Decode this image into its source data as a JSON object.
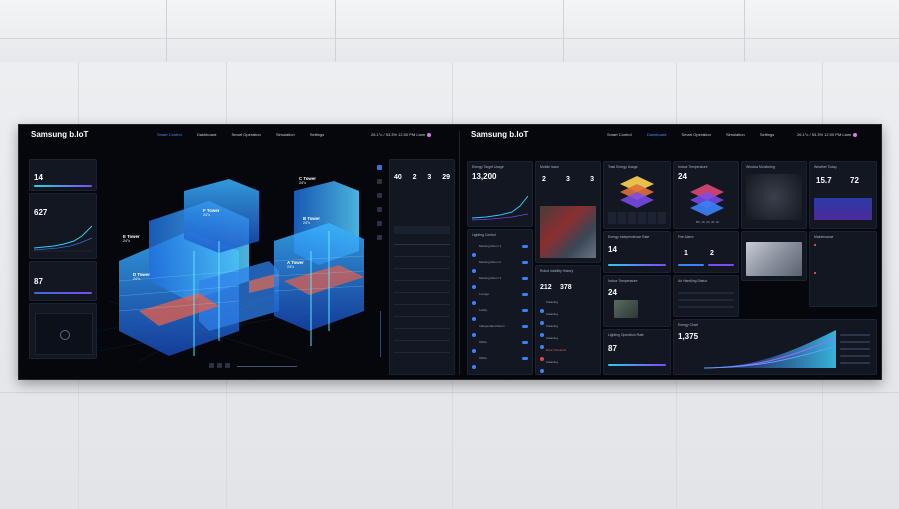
{
  "left": {
    "brand": "Samsung b.IoT",
    "nav": [
      "Smart Control",
      "Dashboard",
      "Smart Operation",
      "Simulation",
      "Settings"
    ],
    "active_nav": "Smart Control",
    "status": "26.1°c / 53.3% 12:00 PM Liam",
    "widgets": {
      "temp_title": "",
      "temp_value": "14",
      "energy_value": "627",
      "pct_value": "87"
    },
    "towers": [
      {
        "name": "E Tower",
        "temp": "24°c"
      },
      {
        "name": "F Tower",
        "temp": "24°c"
      },
      {
        "name": "D Tower",
        "temp": "24°c"
      },
      {
        "name": "C Tower",
        "temp": "24°c"
      },
      {
        "name": "B Tower",
        "temp": "24°c"
      },
      {
        "name": "A Tower",
        "temp": "24°c"
      }
    ],
    "right_panel": {
      "nums": [
        "40",
        "2",
        "3",
        "29"
      ]
    }
  },
  "right": {
    "brand": "Samsung b.IoT",
    "nav": [
      "Smart Control",
      "Dashboard",
      "Smart Operation",
      "Simulation",
      "Settings"
    ],
    "active_nav": "Dashboard",
    "status": "26.1°c / 53.3% 12:00 PM Liam",
    "panels": {
      "energy_target_title": "Energy Target Usage",
      "energy_target_value": "13,200",
      "mobile_issue_title": "Mobile Issue",
      "mobile_issue_nums": [
        "2",
        "3",
        "3"
      ],
      "total_energy_title": "Total Energy Usage",
      "indoor_temp_title": "Indoor Temperature",
      "indoor_temp_value": "24",
      "window_title": "Window Monitoring",
      "weather_title": "Weather Today",
      "weather_temp": "15.7",
      "weather_humidity": "72",
      "lighting_title": "Lighting Control",
      "lighting_items": [
        "Meeting Room 1",
        "Meeting Room 2",
        "Meeting Room 3",
        "Lounge",
        "Lobby",
        "Independent Room",
        "Office",
        "Office"
      ],
      "visibility_title": "Robot visibility History",
      "visibility_nums": [
        "212",
        "378"
      ],
      "visibility_items": [
        "Cleaning",
        "Cleaning",
        "Cleaning",
        "Cleaning",
        "Error Occurred",
        "Cleaning"
      ],
      "energy_ind_title": "Energy Independence Rate",
      "energy_ind_value": "14",
      "fire_title": "Fire Alarm",
      "fire_nums": [
        "1",
        "2"
      ],
      "maintenance_title": "Maintenance",
      "indoor_temp2_title": "Indoor Temperature",
      "indoor_temp2_value": "24",
      "air_title": "Air Handling Status",
      "lighting_rate_title": "Lighting Operation Rate",
      "lighting_rate_value": "87",
      "energy_chart_title": "Energy Chart",
      "energy_chart_value": "1,375",
      "floors_label": "B3, 1F, 2F, 3F, 4F"
    }
  }
}
